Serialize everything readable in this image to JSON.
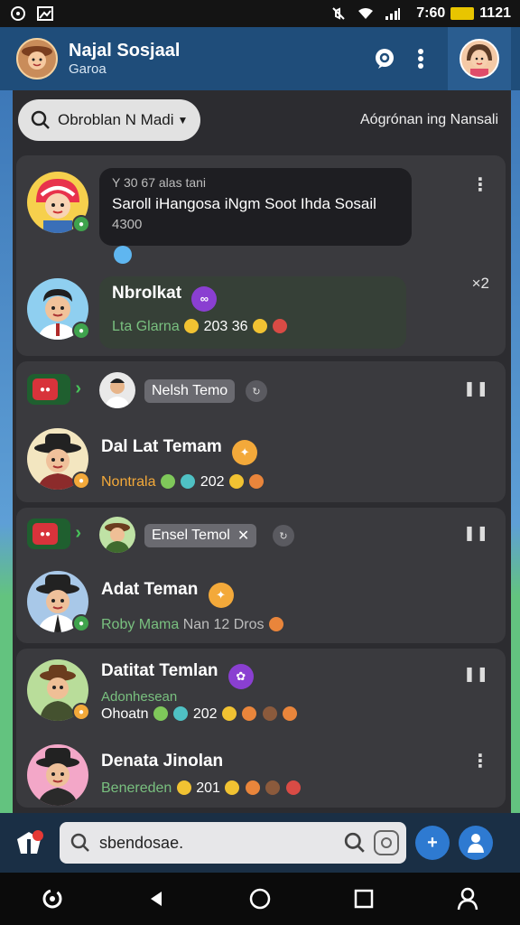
{
  "status_bar": {
    "time": "7:60",
    "right_time": "1121",
    "icons": [
      "app-icon-1",
      "app-icon-2",
      "mute-icon",
      "wifi-icon",
      "signal-icon",
      "battery-icon"
    ]
  },
  "header": {
    "title": "Najal Sosjaal",
    "subtitle": "Garoa",
    "icons": [
      "chat-icon",
      "more-icon",
      "profile-avatar"
    ]
  },
  "filter": {
    "dropdown_label": "Obroblan N Madi",
    "right_text": "Aógrónan ing Nansali"
  },
  "card1": {
    "meta": "Y 30 67 alas tani",
    "message": "Saroll iHangosa iNgm Soot Ihda Sosail",
    "message_sub": "4300",
    "reply_name": "Nbrolkat",
    "reply_sub": "Lta Glarna",
    "reply_count_text": "203 36",
    "side_count": "×2"
  },
  "card2": {
    "chip_label": "Nelsh Temo",
    "name": "Dal Lat Temam",
    "sub_label": "Nontrala",
    "sub_count": "202"
  },
  "card3": {
    "chip_label": "Ensel Temol",
    "name": "Adat Teman",
    "sub_label": "Roby Mama",
    "sub_rest": "Nan 12 Dros"
  },
  "card4": {
    "row1_name": "Datitat Temlan",
    "row1_sub_green": "Adonhesean",
    "row1_sub": "Ohoatn",
    "row1_count": "202",
    "row2_name": "Denata Jinolan",
    "row2_sub": "Benereden",
    "row2_count": "201"
  },
  "bottom": {
    "search_value": "sbendosae.",
    "search_placeholder": ""
  },
  "colors": {
    "header_bg": "#1f4d7a",
    "panel_bg": "#2c2c30",
    "card_bg": "#3a3a3e",
    "accent_green": "#79c07f",
    "accent_orange": "#f3a93a"
  }
}
